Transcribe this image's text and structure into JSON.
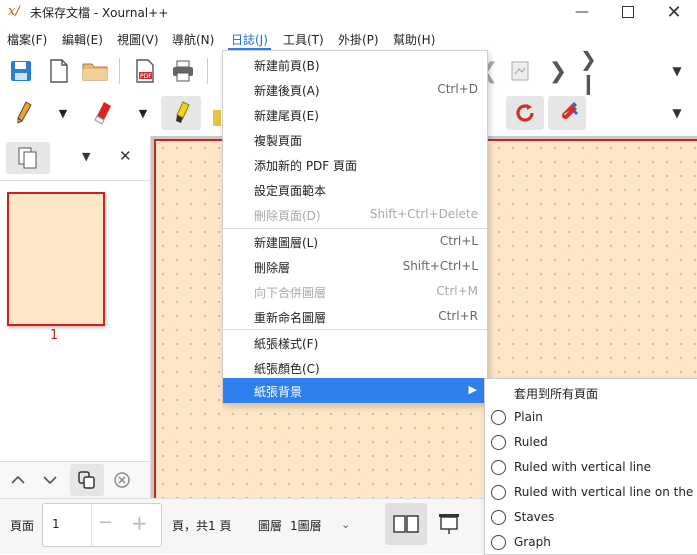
{
  "window": {
    "title": "未保存文檔 - Xournal++",
    "app_icon": "xournal-icon"
  },
  "menubar": {
    "items": [
      {
        "label": "檔案(F)"
      },
      {
        "label": "編輯(E)"
      },
      {
        "label": "視圖(V)"
      },
      {
        "label": "導航(N)"
      },
      {
        "label": "日誌(J)"
      },
      {
        "label": "工具(T)"
      },
      {
        "label": "外掛(P)"
      },
      {
        "label": "幫助(H)"
      }
    ],
    "active_index": 4
  },
  "journal_menu": {
    "items": [
      {
        "label": "新建前頁(B)",
        "shortcut": "",
        "enabled": true
      },
      {
        "label": "新建後頁(A)",
        "shortcut": "Ctrl+D",
        "enabled": true
      },
      {
        "label": "新建尾頁(E)",
        "shortcut": "",
        "enabled": true
      },
      {
        "label": "複製頁面",
        "shortcut": "",
        "enabled": true
      },
      {
        "label": "添加新的 PDF 頁面",
        "shortcut": "",
        "enabled": true
      },
      {
        "label": "設定頁面範本",
        "shortcut": "",
        "enabled": true
      },
      {
        "label": "刪除頁面(D)",
        "shortcut": "Shift+Ctrl+Delete",
        "enabled": false
      },
      {
        "label": "新建圖層(L)",
        "shortcut": "Ctrl+L",
        "enabled": true
      },
      {
        "label": "刪除層",
        "shortcut": "Shift+Ctrl+L",
        "enabled": true
      },
      {
        "label": "向下合併圖層",
        "shortcut": "Ctrl+M",
        "enabled": false
      },
      {
        "label": "重新命名圖層",
        "shortcut": "Ctrl+R",
        "enabled": true
      },
      {
        "label": "紙張樣式(F)",
        "shortcut": "",
        "enabled": true
      },
      {
        "label": "紙張顏色(C)",
        "shortcut": "",
        "enabled": true
      },
      {
        "label": "紙張背景",
        "shortcut": "",
        "enabled": true
      }
    ],
    "highlighted_index": 13
  },
  "background_submenu": {
    "apply_all": "套用到所有頁面",
    "options": [
      {
        "label": "Plain"
      },
      {
        "label": "Ruled"
      },
      {
        "label": "Ruled with vertical line"
      },
      {
        "label": "Ruled with vertical line on the right"
      },
      {
        "label": "Staves"
      },
      {
        "label": "Graph"
      }
    ]
  },
  "sidebar": {
    "page_number": "1"
  },
  "bottombar": {
    "page_label": "頁面",
    "page_value": "1",
    "page_total": "頁，共1 頁",
    "layer_label": "圖層",
    "layer_value": "1圖層"
  },
  "colors": {
    "accent": "#2f80ed",
    "page_bg": "#ffe6c7",
    "page_border": "#d02020"
  }
}
